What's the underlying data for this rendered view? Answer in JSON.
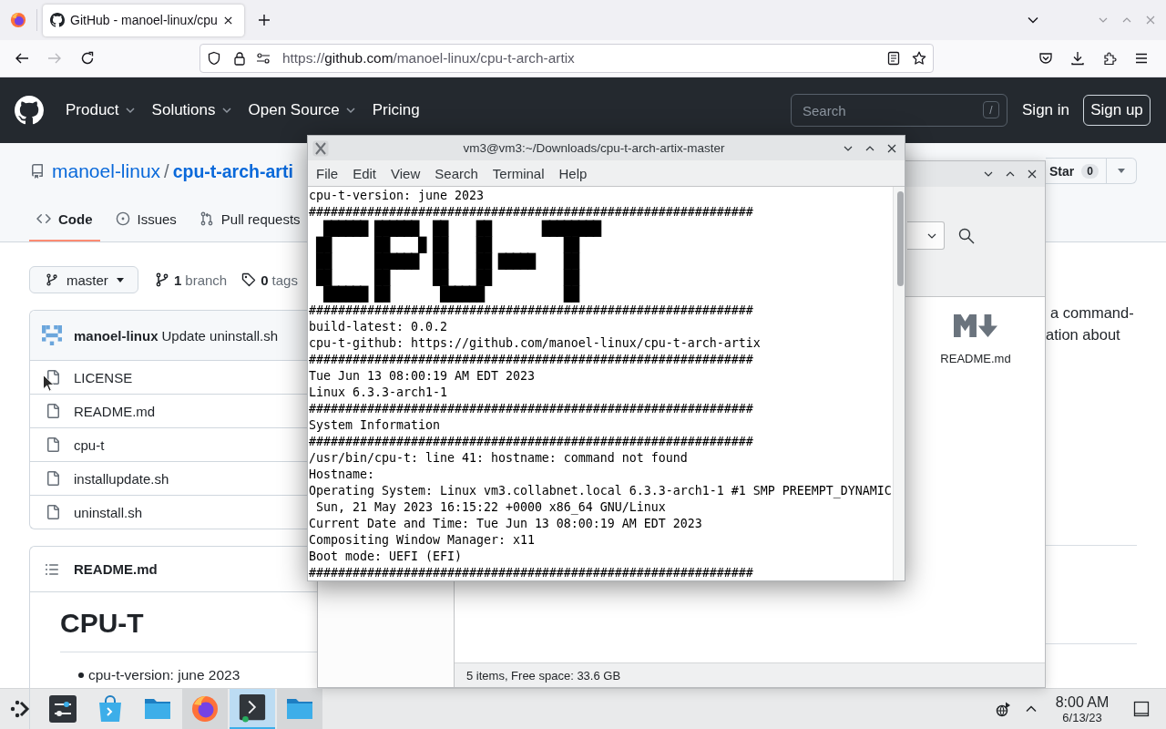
{
  "browser": {
    "tabs": [
      {
        "title": "GitHub - manoel-linux/cpu",
        "selected": true
      }
    ],
    "forward": {
      "disabled": true
    },
    "url": {
      "scheme": "https://",
      "host": "github.com",
      "path": "/manoel-linux/cpu-t-arch-artix"
    }
  },
  "github": {
    "nav": [
      {
        "label": "Product",
        "menu": true
      },
      {
        "label": "Solutions",
        "menu": true
      },
      {
        "label": "Open Source",
        "menu": true
      },
      {
        "label": "Pricing",
        "menu": false
      }
    ],
    "search": {
      "placeholder": "Search",
      "shortcut": "/"
    },
    "sign_in": "Sign in",
    "sign_up": "Sign up",
    "repo": {
      "owner": "manoel-linux",
      "separator": "/",
      "name": "cpu-t-arch-arti"
    },
    "star": {
      "label": "Star",
      "count": "0"
    },
    "tabs": [
      {
        "label": "Code",
        "kind": "code",
        "selected": true
      },
      {
        "label": "Issues",
        "kind": "issues",
        "selected": false
      },
      {
        "label": "Pull requests",
        "kind": "pulls",
        "selected": false
      }
    ],
    "branch": "master",
    "refs": [
      {
        "kind": "branch",
        "count": "1",
        "label": "branch"
      },
      {
        "kind": "tag",
        "count": "0",
        "label": "tags"
      }
    ],
    "commit": {
      "author": "manoel-linux",
      "message": "Update uninstall.sh"
    },
    "files": [
      "LICENSE",
      "README.md",
      "cpu-t",
      "installupdate.sh",
      "uninstall.sh"
    ],
    "readme": {
      "title": "README.md",
      "heading": "CPU-T",
      "bullets": [
        "cpu-t-version: june 2023"
      ]
    },
    "about": [
      "a command-",
      "ation about"
    ]
  },
  "file_manager": {
    "items": [
      {
        "name": "README.md"
      }
    ],
    "status": "5 items, Free space: 33.6 GB"
  },
  "terminal": {
    "title": "vm3@vm3:~/Downloads/cpu-t-arch-artix-master",
    "menu": [
      "File",
      "Edit",
      "View",
      "Search",
      "Terminal",
      "Help"
    ],
    "lines": [
      {
        "kind": "text",
        "text": "cpu-t-version: june 2023"
      },
      {
        "kind": "text",
        "text": "#############################################################"
      },
      {
        "kind": "art",
        "rows": [
          "  ██████ ██████  ██    ██       ████████",
          " ██      ██    █ ██    ██          ██",
          " ██      ██████  ██    ██ █████    ██",
          " ██      ██      ██    ██          ██",
          "  ██████ ██       ██████           ██"
        ]
      },
      {
        "kind": "text",
        "text": "#############################################################"
      },
      {
        "kind": "text",
        "text": "build-latest: 0.0.2"
      },
      {
        "kind": "text",
        "text": "cpu-t-github: https://github.com/manoel-linux/cpu-t-arch-artix"
      },
      {
        "kind": "text",
        "text": "#############################################################"
      },
      {
        "kind": "text",
        "text": "Tue Jun 13 08:00:19 AM EDT 2023"
      },
      {
        "kind": "text",
        "text": "Linux 6.3.3-arch1-1"
      },
      {
        "kind": "text",
        "text": "#############################################################"
      },
      {
        "kind": "text",
        "text": "System Information"
      },
      {
        "kind": "text",
        "text": "#############################################################"
      },
      {
        "kind": "text",
        "text": "/usr/bin/cpu-t: line 41: hostname: command not found"
      },
      {
        "kind": "text",
        "text": "Hostname:"
      },
      {
        "kind": "text",
        "text": "Operating System: Linux vm3.collabnet.local 6.3.3-arch1-1 #1 SMP PREEMPT_DYNAMIC"
      },
      {
        "kind": "text",
        "text": " Sun, 21 May 2023 16:15:22 +0000 x86_64 GNU/Linux"
      },
      {
        "kind": "text",
        "text": "Current Date and Time: Tue Jun 13 08:00:19 AM EDT 2023"
      },
      {
        "kind": "text",
        "text": "Compositing Window Manager: x11"
      },
      {
        "kind": "text",
        "text": "Boot mode: UEFI (EFI)"
      },
      {
        "kind": "text",
        "text": "#############################################################"
      }
    ]
  },
  "taskbar": {
    "tasks": [
      {
        "kind": "settings",
        "running": false,
        "selected": false
      },
      {
        "kind": "store",
        "running": false,
        "selected": false
      },
      {
        "kind": "folder",
        "running": false,
        "selected": false
      },
      {
        "kind": "browser",
        "running": true,
        "selected": false
      },
      {
        "kind": "terminal",
        "running": true,
        "selected": true
      },
      {
        "kind": "folder",
        "running": true,
        "selected": false
      }
    ],
    "time": "8:00 AM",
    "date": "6/13/23"
  }
}
